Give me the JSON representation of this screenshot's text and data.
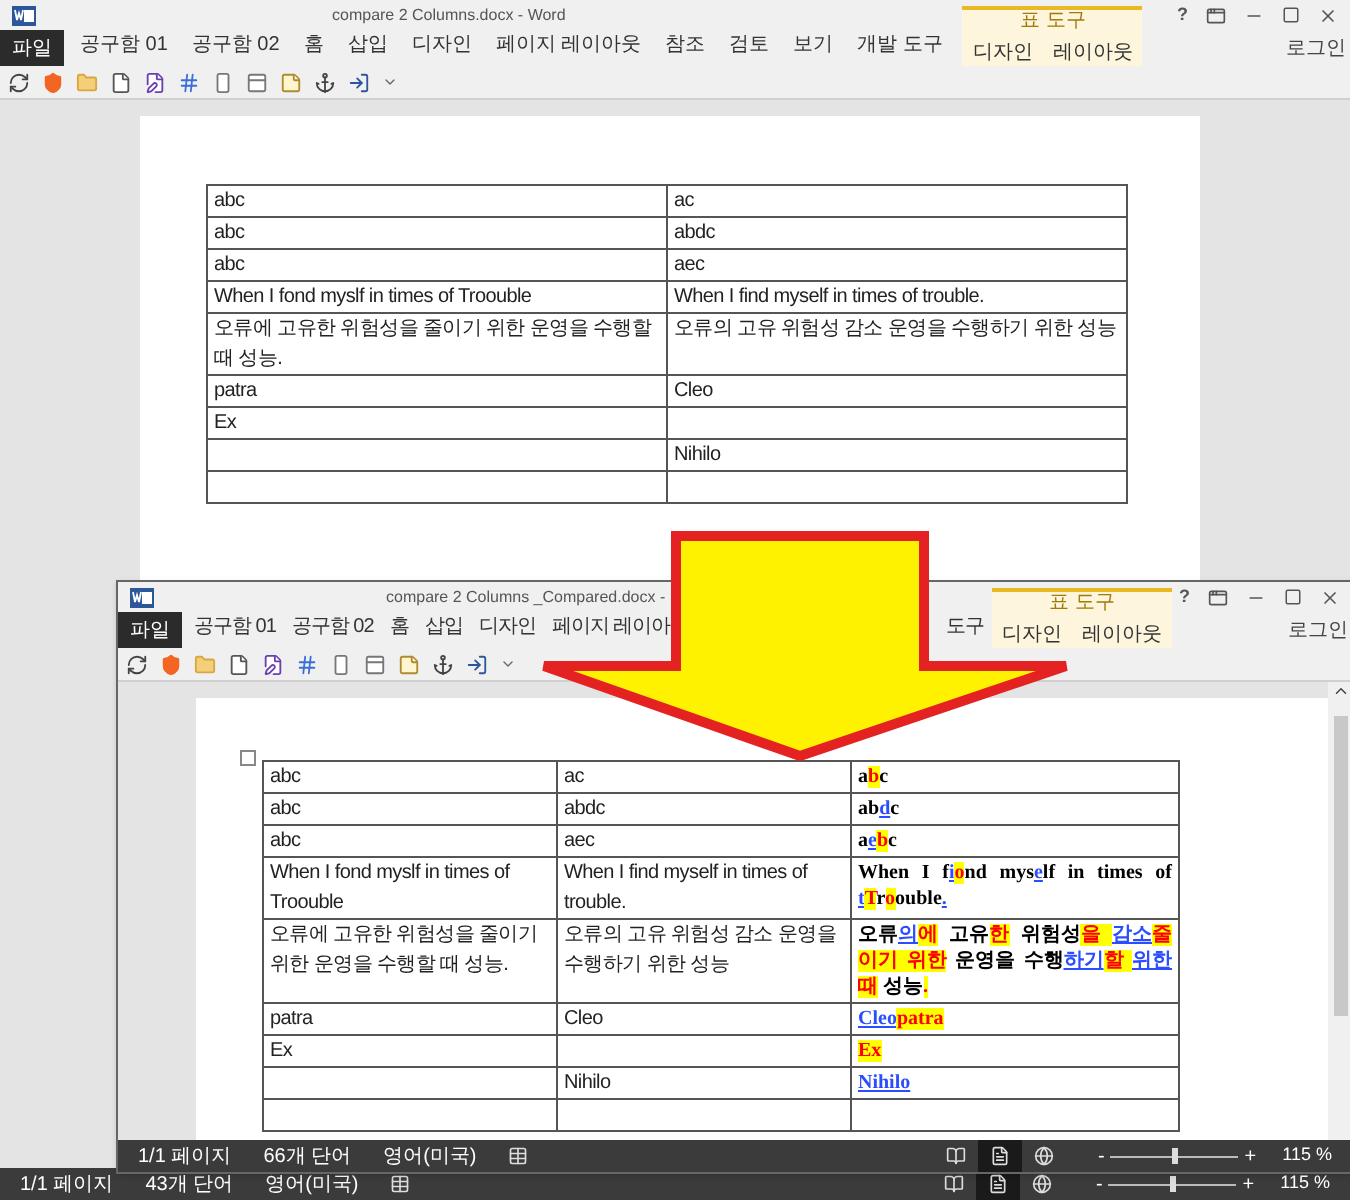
{
  "original_window": {
    "kind": "original",
    "title": "compare 2 Columns.docx - Word",
    "help": "?",
    "file_tab": "파일",
    "tabs": [
      {
        "label": "공구함 01",
        "selected": false
      },
      {
        "label": "공구함 02",
        "selected": false
      },
      {
        "label": "홈",
        "selected": false
      },
      {
        "label": "삽입",
        "selected": false
      },
      {
        "label": "디자인",
        "selected": false
      },
      {
        "label": "페이지 레이아웃",
        "selected": false
      },
      {
        "label": "참조",
        "selected": false
      },
      {
        "label": "검토",
        "selected": false
      },
      {
        "label": "보기",
        "selected": false
      },
      {
        "label": "개발 도구",
        "selected": false
      }
    ],
    "contextual_group": {
      "title": "표 도구",
      "tabs": [
        {
          "label": "디자인",
          "selected": false
        },
        {
          "label": "레이아웃",
          "selected": false
        }
      ]
    },
    "account": "로그인",
    "table": {
      "rows": [
        {
          "column_1": "abc",
          "column_2": "ac"
        },
        {
          "column_1": "abc",
          "column_2": "abdc"
        },
        {
          "column_1": "abc",
          "column_2": "aec"
        },
        {
          "column_1": "When I fond myslf in times of Troouble",
          "column_2": "When I find myself in times of trouble."
        },
        {
          "column_1": "오류에 고유한 위험성을 줄이기 위한 운영을 수행할 때 성능.",
          "column_2": "오류의 고유 위험성 감소 운영을 수행하기 위한 성능"
        },
        {
          "column_1": "patra",
          "column_2": "Cleo"
        },
        {
          "column_1": "Ex"
        },
        {
          "column_2": "Nihilo"
        },
        {}
      ]
    },
    "status_bar": {
      "page": "1/1 페이지",
      "words": "43개 단어",
      "language": "영어(미국)",
      "views": [
        {
          "kind": "read",
          "selected": false
        },
        {
          "kind": "print",
          "selected": true
        },
        {
          "kind": "web",
          "selected": false
        }
      ],
      "zoom": {
        "minus": "-",
        "plus": "+",
        "level": 0.5,
        "reading": "115 %"
      }
    }
  },
  "compared_window": {
    "kind": "compared",
    "title": "compare 2 Columns _Compared.docx -",
    "help": "?",
    "file_tab": "파일",
    "tabs": [
      {
        "label": "공구함 01",
        "selected": false
      },
      {
        "label": "공구함 02",
        "selected": false
      },
      {
        "label": "홈",
        "selected": false
      },
      {
        "label": "삽입",
        "selected": false
      },
      {
        "label": "디자인",
        "selected": false
      },
      {
        "label": "페이지 레이아",
        "selected": false
      },
      {
        "label": "도구",
        "selected": false
      }
    ],
    "contextual_group": {
      "title": "표 도구",
      "tabs": [
        {
          "label": "디자인",
          "selected": false
        },
        {
          "label": "레이아웃",
          "selected": false
        }
      ]
    },
    "account": "로그인",
    "table": {
      "rows": [
        {
          "column_1": "abc",
          "column_2": "ac",
          "comparison": [
            {
              "text": "a",
              "kind": "same"
            },
            {
              "text": "b",
              "kind": "deleted"
            },
            {
              "text": "c",
              "kind": "same"
            }
          ]
        },
        {
          "column_1": "abc",
          "column_2": "abdc",
          "comparison": [
            {
              "text": "ab",
              "kind": "same"
            },
            {
              "text": "d",
              "kind": "inserted"
            },
            {
              "text": "c",
              "kind": "same"
            }
          ]
        },
        {
          "column_1": "abc",
          "column_2": "aec",
          "comparison": [
            {
              "text": "a",
              "kind": "same"
            },
            {
              "text": "e",
              "kind": "inserted"
            },
            {
              "text": "b",
              "kind": "deleted"
            },
            {
              "text": "c",
              "kind": "same"
            }
          ]
        },
        {
          "column_1": "When I fond myslf in times of Troouble",
          "column_2": "When I find myself in times of trouble.",
          "comparison": [
            {
              "text": "When I f",
              "kind": "same"
            },
            {
              "text": "i",
              "kind": "inserted"
            },
            {
              "text": "o",
              "kind": "deleted"
            },
            {
              "text": "nd mys",
              "kind": "same"
            },
            {
              "text": "e",
              "kind": "inserted"
            },
            {
              "text": "lf in times of ",
              "kind": "same"
            },
            {
              "text": "t",
              "kind": "inserted"
            },
            {
              "text": "T",
              "kind": "deleted"
            },
            {
              "text": "r",
              "kind": "same"
            },
            {
              "text": "o",
              "kind": "deleted"
            },
            {
              "text": "ouble",
              "kind": "same"
            },
            {
              "text": ".",
              "kind": "inserted"
            }
          ]
        },
        {
          "column_1": "오류에 고유한 위험성을 줄이기 위한 운영을 수행할 때 성능.",
          "column_2": "오류의 고유 위험성 감소 운영을 수행하기 위한 성능",
          "comparison": [
            {
              "text": "오류",
              "kind": "same"
            },
            {
              "text": "의",
              "kind": "inserted"
            },
            {
              "text": "에",
              "kind": "deleted"
            },
            {
              "text": " 고유",
              "kind": "same"
            },
            {
              "text": "한",
              "kind": "deleted"
            },
            {
              "text": " 위험성",
              "kind": "same"
            },
            {
              "text": "을 ",
              "kind": "deleted"
            },
            {
              "text": "감소",
              "kind": "inserted"
            },
            {
              "text": "줄이기 위한",
              "kind": "deleted"
            },
            {
              "text": " 운영을 수행",
              "kind": "same"
            },
            {
              "text": "하기",
              "kind": "inserted"
            },
            {
              "text": "할 ",
              "kind": "deleted"
            },
            {
              "text": "위한",
              "kind": "inserted"
            },
            {
              "text": "때",
              "kind": "deleted"
            },
            {
              "text": " 성능",
              "kind": "same"
            },
            {
              "text": ".",
              "kind": "deleted"
            }
          ]
        },
        {
          "column_1": "patra",
          "column_2": "Cleo",
          "comparison": [
            {
              "text": "Cleo",
              "kind": "inserted"
            },
            {
              "text": "patra",
              "kind": "deleted"
            }
          ]
        },
        {
          "column_1": "Ex",
          "comparison": [
            {
              "text": "Ex",
              "kind": "deleted"
            }
          ]
        },
        {
          "column_2": "Nihilo",
          "comparison": [
            {
              "text": "Nihilo",
              "kind": "inserted"
            }
          ]
        },
        {}
      ]
    },
    "status_bar": {
      "page": "1/1 페이지",
      "words": "66개 단어",
      "language": "영어(미국)",
      "views": [
        {
          "kind": "read",
          "selected": false
        },
        {
          "kind": "print",
          "selected": true
        },
        {
          "kind": "web",
          "selected": false
        }
      ],
      "zoom": {
        "minus": "-",
        "plus": "+",
        "level": 0.5,
        "reading": "115 %"
      }
    }
  }
}
